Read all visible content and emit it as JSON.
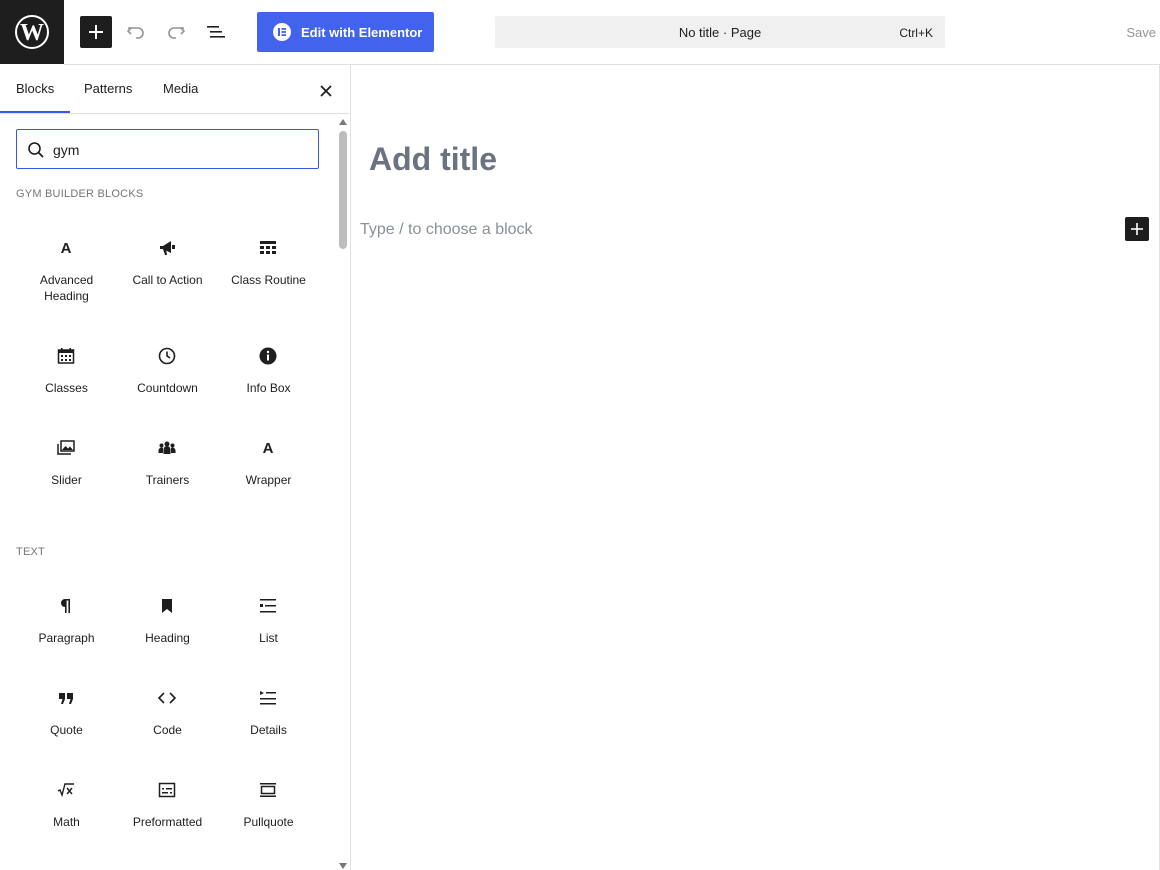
{
  "header": {
    "elementor_label": "Edit with Elementor",
    "document_title": "No title · Page",
    "shortcut": "Ctrl+K",
    "save_label": "Save"
  },
  "sidebar": {
    "tabs": [
      {
        "label": "Blocks",
        "active": true
      },
      {
        "label": "Patterns",
        "active": false
      },
      {
        "label": "Media",
        "active": false
      }
    ],
    "search": {
      "value": "gym",
      "placeholder": "Search"
    },
    "categories": [
      {
        "title": "Gym Builder Blocks",
        "blocks": [
          {
            "label": "Advanced Heading",
            "icon": "letter-a-icon"
          },
          {
            "label": "Call to Action",
            "icon": "megaphone-icon"
          },
          {
            "label": "Class Routine",
            "icon": "table-icon"
          },
          {
            "label": "Classes",
            "icon": "calendar-icon"
          },
          {
            "label": "Countdown",
            "icon": "clock-icon"
          },
          {
            "label": "Info Box",
            "icon": "info-icon"
          },
          {
            "label": "Slider",
            "icon": "images-icon"
          },
          {
            "label": "Trainers",
            "icon": "users-icon"
          },
          {
            "label": "Wrapper",
            "icon": "letter-a-icon"
          }
        ]
      },
      {
        "title": "Text",
        "blocks": [
          {
            "label": "Paragraph",
            "icon": "pilcrow-icon"
          },
          {
            "label": "Heading",
            "icon": "bookmark-icon"
          },
          {
            "label": "List",
            "icon": "list-icon"
          },
          {
            "label": "Quote",
            "icon": "quote-icon"
          },
          {
            "label": "Code",
            "icon": "code-icon"
          },
          {
            "label": "Details",
            "icon": "details-icon"
          },
          {
            "label": "Math",
            "icon": "math-icon"
          },
          {
            "label": "Preformatted",
            "icon": "preformatted-icon"
          },
          {
            "label": "Pullquote",
            "icon": "pullquote-icon"
          }
        ]
      }
    ]
  },
  "canvas": {
    "title_placeholder": "Add title",
    "block_placeholder": "Type / to choose a block"
  },
  "colors": {
    "accent": "#3858e9",
    "elementor": "#4163ee",
    "dark": "#1e1e1e"
  }
}
